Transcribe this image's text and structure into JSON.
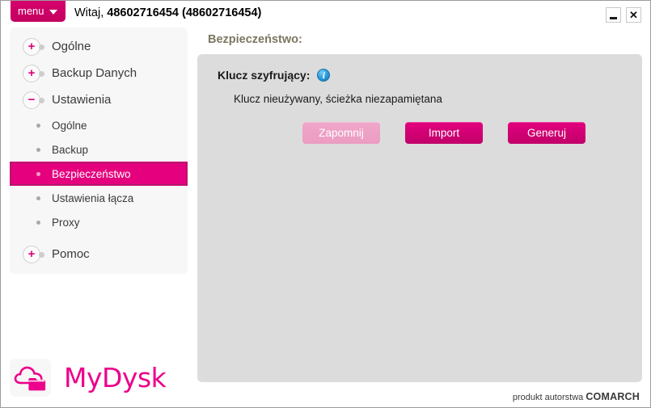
{
  "window": {
    "menu_button_label": "menu",
    "greeting_prefix": "Witaj, ",
    "account_id": "48602716454 (48602716454)",
    "minimize_label": "–",
    "close_label": "✕"
  },
  "sidebar": {
    "top_items": [
      {
        "label": "Ogólne",
        "sign": "+",
        "expanded": false
      },
      {
        "label": "Backup Danych",
        "sign": "+",
        "expanded": false
      },
      {
        "label": "Ustawienia",
        "sign": "−",
        "expanded": true
      }
    ],
    "sub_items": [
      {
        "label": "Ogólne",
        "selected": false
      },
      {
        "label": "Backup",
        "selected": false
      },
      {
        "label": "Bezpieczeństwo",
        "selected": true
      },
      {
        "label": "Ustawienia łącza",
        "selected": false
      },
      {
        "label": "Proxy",
        "selected": false
      }
    ],
    "help_item": {
      "label": "Pomoc",
      "sign": "+",
      "expanded": false
    }
  },
  "content": {
    "heading": "Bezpieczeństwo:",
    "key_label": "Klucz szyfrujący:",
    "info_icon_glyph": "i",
    "key_status": "Klucz nieużywany, ścieżka niezapamiętana",
    "buttons": [
      {
        "label": "Zapomnij",
        "disabled": true
      },
      {
        "label": "Import",
        "disabled": false
      },
      {
        "label": "Generuj",
        "disabled": false
      }
    ]
  },
  "footer": {
    "logo_text": "MyDysk",
    "logo_icon": "cloud-folder-icon",
    "credit_prefix": "produkt autorstwa ",
    "credit_brand": "COMARCH"
  },
  "colors": {
    "brand_pink": "#e5007d",
    "brand_pink_dark": "#c1006a",
    "brand_pink_light": "#f0a6c9",
    "logo_pink": "#ec008c",
    "heading_olive": "#7c7660",
    "panel_gray": "#dcdcdc",
    "sidebar_gray": "#f7f7f7",
    "info_blue": "#2e9fe0"
  }
}
